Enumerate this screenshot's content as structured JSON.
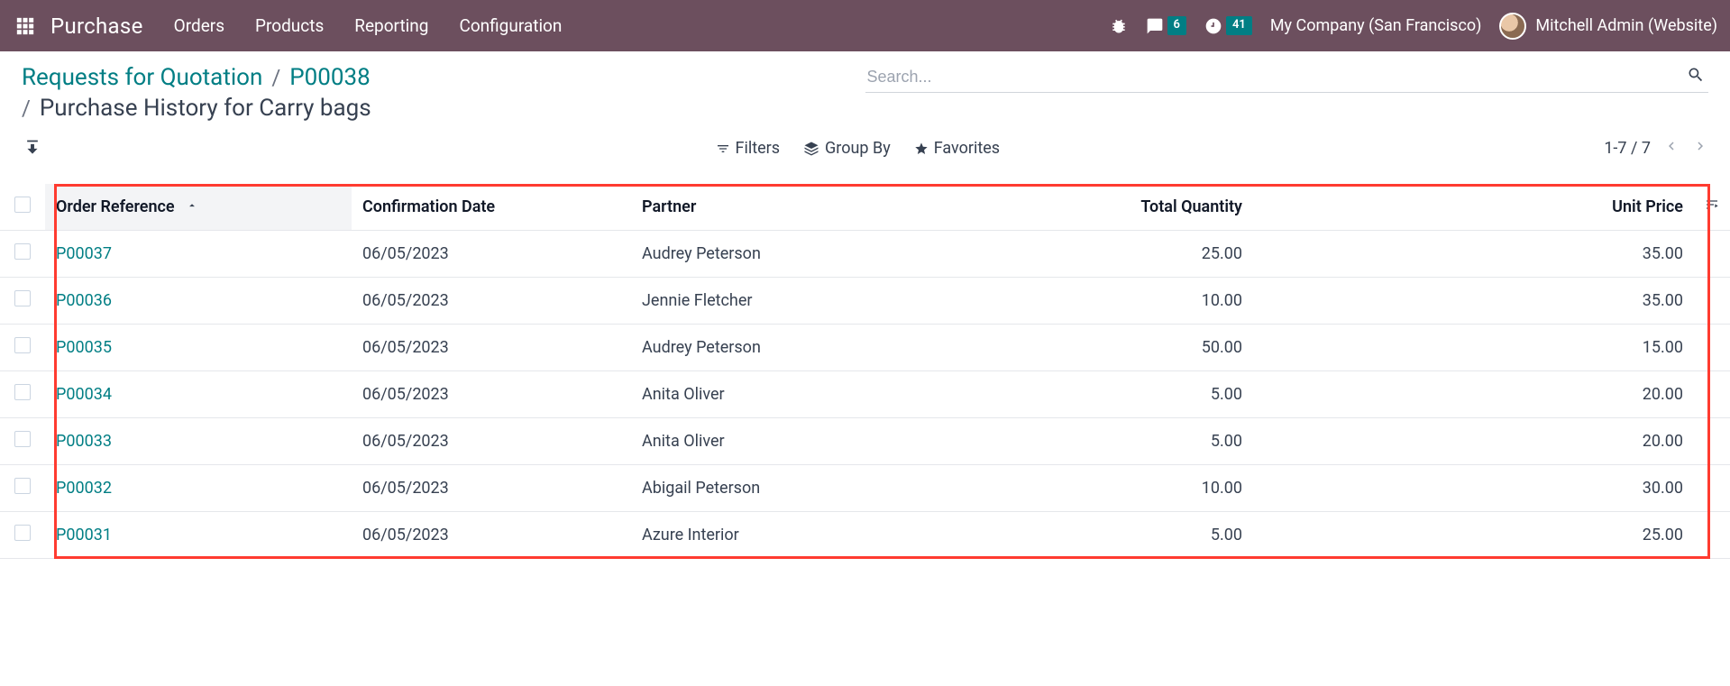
{
  "nav": {
    "brand": "Purchase",
    "links": [
      "Orders",
      "Products",
      "Reporting",
      "Configuration"
    ],
    "messages_badge": "6",
    "activities_badge": "41",
    "company": "My Company (San Francisco)",
    "user": "Mitchell Admin (Website)"
  },
  "breadcrumb": {
    "parent1": "Requests for Quotation",
    "parent2": "P00038",
    "current_prefix": "/",
    "current": "Purchase History for Carry bags"
  },
  "search": {
    "placeholder": "Search..."
  },
  "toolbar": {
    "filters": "Filters",
    "group_by": "Group By",
    "favorites": "Favorites",
    "pager": "1-7 / 7"
  },
  "table": {
    "headers": {
      "order_ref": "Order Reference",
      "confirm_date": "Confirmation Date",
      "partner": "Partner",
      "total_qty": "Total Quantity",
      "unit_price": "Unit Price"
    },
    "rows": [
      {
        "ref": "P00037",
        "date": "06/05/2023",
        "partner": "Audrey Peterson",
        "qty": "25.00",
        "price": "35.00"
      },
      {
        "ref": "P00036",
        "date": "06/05/2023",
        "partner": "Jennie Fletcher",
        "qty": "10.00",
        "price": "35.00"
      },
      {
        "ref": "P00035",
        "date": "06/05/2023",
        "partner": "Audrey Peterson",
        "qty": "50.00",
        "price": "15.00"
      },
      {
        "ref": "P00034",
        "date": "06/05/2023",
        "partner": "Anita Oliver",
        "qty": "5.00",
        "price": "20.00"
      },
      {
        "ref": "P00033",
        "date": "06/05/2023",
        "partner": "Anita Oliver",
        "qty": "5.00",
        "price": "20.00"
      },
      {
        "ref": "P00032",
        "date": "06/05/2023",
        "partner": "Abigail Peterson",
        "qty": "10.00",
        "price": "30.00"
      },
      {
        "ref": "P00031",
        "date": "06/05/2023",
        "partner": "Azure Interior",
        "qty": "5.00",
        "price": "25.00"
      }
    ]
  }
}
